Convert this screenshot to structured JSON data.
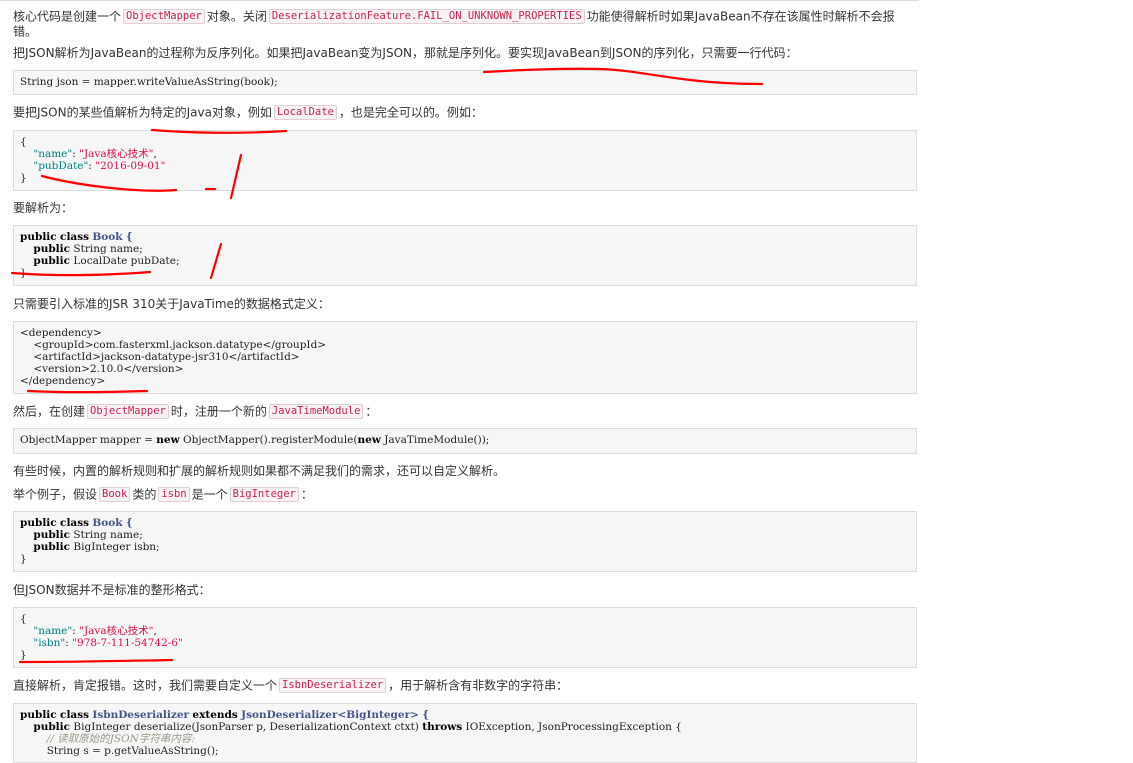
{
  "article": {
    "p1": {
      "t1": "核心代码是创建一个",
      "c1": "ObjectMapper",
      "t2": "对象。关闭",
      "c2": "DeserializationFeature.FAIL_ON_UNKNOWN_PROPERTIES",
      "t3": "功能使得解析时如果JavaBean不存在该属性时解析不会报",
      "line2": "错。"
    },
    "p2": "把JSON解析为JavaBean的过程称为反序列化。如果把JavaBean变为JSON，那就是序列化。要实现JavaBean到JSON的序列化，只需要一行代码：",
    "code1": [
      "String json = mapper.writeValueAsString(book);"
    ],
    "p3": {
      "t1": "要把JSON的某些值解析为特定的Java对象，例如",
      "c1": "LocalDate",
      "t2": "，也是完全可以的。例如："
    },
    "code2": {
      "open": "{",
      "line1": {
        "key": "\"name\"",
        "sep": ": ",
        "val": "\"Java核心技术\"",
        "end": ","
      },
      "line2": {
        "key": "\"pubDate\"",
        "sep": ": ",
        "val": "\"2016-09-01\""
      },
      "close": "}"
    },
    "p4": "要解析为：",
    "code3": {
      "kw1": "public",
      "kw2": "class",
      "cls": "Book",
      "brace": "{",
      "line1": {
        "kw": "public",
        "rest": " String name;"
      },
      "line2": {
        "kw": "public",
        "rest": " LocalDate pubDate;"
      },
      "close": "}"
    },
    "p5": "只需要引入标准的JSR 310关于JavaTime的数据格式定义：",
    "code4": [
      "<dependency>",
      "    <groupId>com.fasterxml.jackson.datatype</groupId>",
      "    <artifactId>jackson-datatype-jsr310</artifactId>",
      "    <version>2.10.0</version>",
      "</dependency>"
    ],
    "p6": {
      "t1": "然后，在创建",
      "c1": "ObjectMapper",
      "t2": "时，注册一个新的",
      "c2": "JavaTimeModule",
      "t3": "："
    },
    "code5": {
      "a": "ObjectMapper mapper = ",
      "kw1": "new",
      "b": " ObjectMapper().registerModule(",
      "kw2": "new",
      "c": " JavaTimeModule());"
    },
    "p7": "有些时候，内置的解析规则和扩展的解析规则如果都不满足我们的需求，还可以自定义解析。",
    "p8": {
      "t1": "举个例子，假设",
      "c1": "Book",
      "t2": "类的",
      "c2": "isbn",
      "t3": "是一个",
      "c3": "BigInteger",
      "t4": "："
    },
    "code6": {
      "kw1": "public",
      "kw2": "class",
      "cls": "Book",
      "brace": "{",
      "line1": {
        "kw": "public",
        "rest": " String name;"
      },
      "line2": {
        "kw": "public",
        "rest": " BigInteger isbn;"
      },
      "close": "}"
    },
    "p9": "但JSON数据并不是标准的整形格式：",
    "code7": {
      "open": "{",
      "line1": {
        "key": "\"name\"",
        "sep": ": ",
        "val": "\"Java核心技术\"",
        "end": ","
      },
      "line2": {
        "key": "\"isbn\"",
        "sep": ": ",
        "val": "\"978-7-111-54742-6\""
      },
      "close": "}"
    },
    "p10": {
      "t1": "直接解析，肯定报错。这时，我们需要自定义一个",
      "c1": "IsbnDeserializer",
      "t2": "，用于解析含有非数字的字符串："
    },
    "code8": {
      "l1": {
        "kw1": "public",
        "kw2": "class",
        "cls1": "IsbnDeserializer",
        "kw3": "extends",
        "cls2": "JsonDeserializer<BigInteger>",
        "brace": "{"
      },
      "l2": {
        "kw1": "public",
        "a": " BigInteger deserialize(JsonParser p, DeserializationContext ctxt) ",
        "kw2": "throws",
        "b": " IOException, JsonProcessingException {"
      },
      "l3": "// 读取原始的JSON字符串内容:",
      "l4": "String s = p.getValueAsString();"
    }
  },
  "colors": {
    "inline_code_text": "#c7254e",
    "inline_code_bg": "#f9f2f4",
    "code_bg": "#f6f6f6",
    "annotation_red": "#ff0000",
    "json_key": "#008080",
    "json_string": "#dd1144"
  }
}
